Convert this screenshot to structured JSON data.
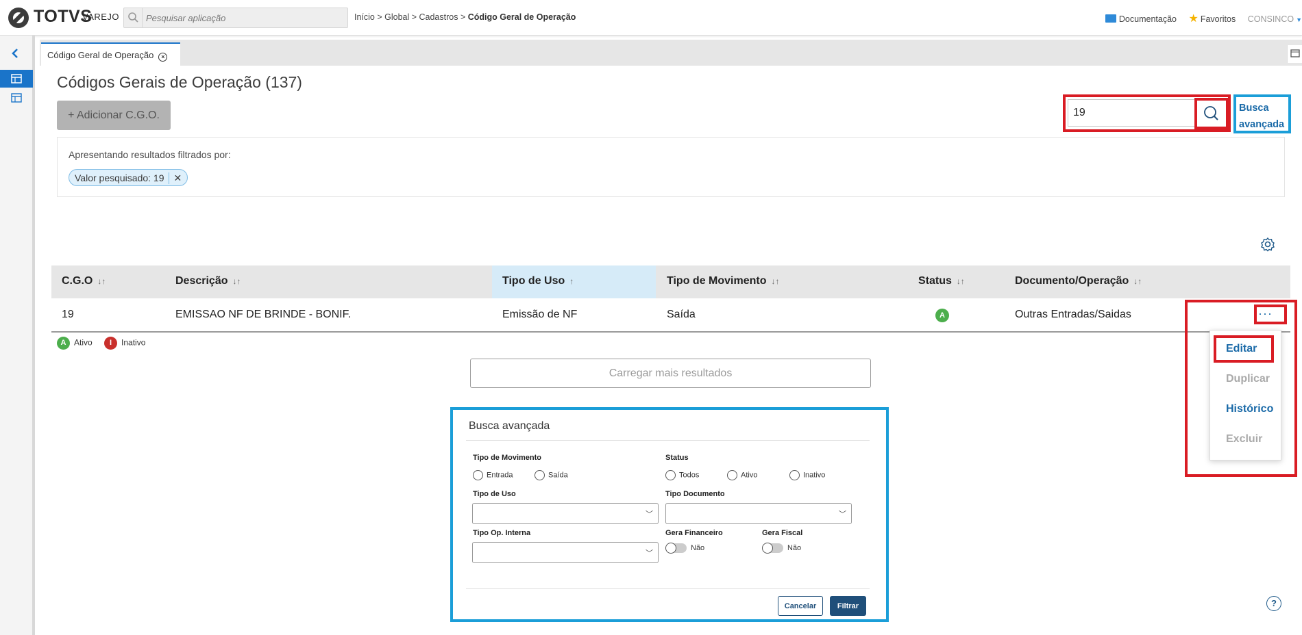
{
  "header": {
    "brand": "TOTVS",
    "brand_sub": "VAREJO",
    "search_placeholder": "Pesquisar aplicação",
    "breadcrumb_path": "Início > Global > Cadastros > ",
    "breadcrumb_current": "Código Geral de Operação",
    "documentation": "Documentação",
    "favorites": "Favoritos",
    "user": "CONSINCO"
  },
  "tab": {
    "label": "Código Geral de Operação"
  },
  "page": {
    "title": "Códigos Gerais de Operação (137)",
    "add_button": "+ Adicionar C.G.O.",
    "search_value": "19",
    "advanced_link": "Busca avançada",
    "filter_label": "Apresentando resultados filtrados por:",
    "chip": "Valor pesquisado: 19"
  },
  "table": {
    "columns": [
      "C.G.O",
      "Descrição",
      "Tipo de Uso",
      "Tipo de Movimento",
      "Status",
      "Documento/Operação"
    ],
    "row": {
      "cgo": "19",
      "descricao": "EMISSAO NF DE BRINDE - BONIF.",
      "tipo_uso": "Emissão de NF",
      "tipo_movimento": "Saída",
      "status": "A",
      "documento": "Outras Entradas/Saidas"
    },
    "actions": [
      "Editar",
      "Duplicar",
      "Histórico",
      "Excluir"
    ]
  },
  "legend": {
    "active_badge": "A",
    "active": "Ativo",
    "inactive_badge": "I",
    "inactive": "Inativo"
  },
  "load_more": "Carregar mais resultados",
  "advanced": {
    "title": "Busca avançada",
    "tipo_movimento": "Tipo de Movimento",
    "entrada": "Entrada",
    "saida": "Saída",
    "status": "Status",
    "todos": "Todos",
    "ativo": "Ativo",
    "inativo": "Inativo",
    "tipo_uso": "Tipo de Uso",
    "tipo_documento": "Tipo Documento",
    "tipo_op_interna": "Tipo Op. Interna",
    "gera_financeiro": "Gera Financeiro",
    "gera_fiscal": "Gera Fiscal",
    "nao": "Não",
    "cancel": "Cancelar",
    "filter": "Filtrar"
  },
  "colors": {
    "accent": "#1a74c9",
    "highlight_red": "#d91c24",
    "highlight_blue": "#1b9ed8",
    "primary_dark": "#1f4f7a"
  }
}
